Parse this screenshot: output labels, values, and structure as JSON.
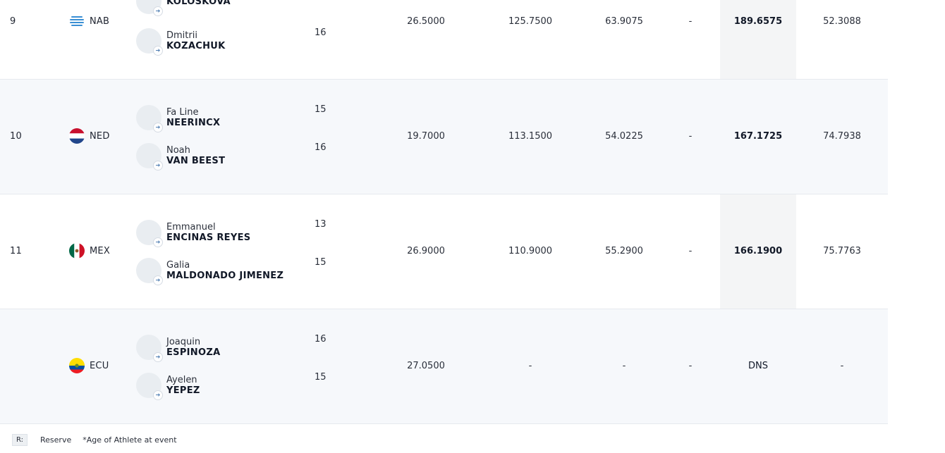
{
  "rows": [
    {
      "rank": "9",
      "nat": "NAB",
      "flag": "nab",
      "athletes": [
        {
          "first": "",
          "last": "KOLOSKOVA",
          "age": ""
        },
        {
          "first": "Dmitrii",
          "last": "KOZACHUK",
          "age": "16"
        }
      ],
      "scores": [
        "26.5000",
        "125.7500",
        "63.9075",
        "-",
        "189.6575",
        "52.3088"
      ]
    },
    {
      "rank": "10",
      "nat": "NED",
      "flag": "ned",
      "athletes": [
        {
          "first": "Fa Line",
          "last": "NEERINCX",
          "age": "15"
        },
        {
          "first": "Noah",
          "last": "VAN BEEST",
          "age": "16"
        }
      ],
      "scores": [
        "19.7000",
        "113.1500",
        "54.0225",
        "-",
        "167.1725",
        "74.7938"
      ]
    },
    {
      "rank": "11",
      "nat": "MEX",
      "flag": "mex",
      "athletes": [
        {
          "first": "Emmanuel",
          "last": "ENCINAS REYES",
          "age": "13"
        },
        {
          "first": "Galia",
          "last": "MALDONADO JIMENEZ",
          "age": "15"
        }
      ],
      "scores": [
        "26.9000",
        "110.9000",
        "55.2900",
        "-",
        "166.1900",
        "75.7763"
      ]
    },
    {
      "rank": "",
      "nat": "ECU",
      "flag": "ecu",
      "athletes": [
        {
          "first": "Joaquin",
          "last": "ESPINOZA",
          "age": "16"
        },
        {
          "first": "Ayelen",
          "last": "YEPEZ",
          "age": "15"
        }
      ],
      "scores": [
        "27.0500",
        "-",
        "-",
        "-",
        "DNS",
        "-"
      ]
    }
  ],
  "footer": {
    "reserve_badge": "R:",
    "reserve_label": "Reserve",
    "age_note": "*Age of Athlete at event"
  },
  "icons": {
    "profile_link": "arrow-right-icon"
  }
}
